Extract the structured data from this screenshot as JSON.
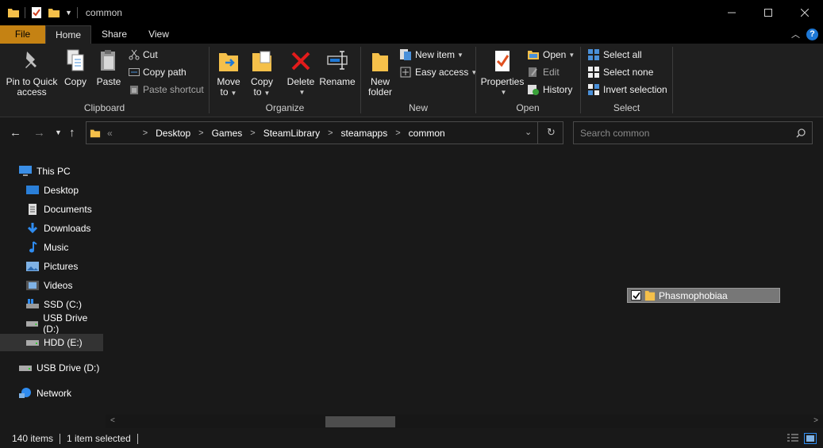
{
  "window": {
    "title": "common",
    "controls": [
      "minimize",
      "maximize",
      "close"
    ]
  },
  "tabs": [
    {
      "label": "File"
    },
    {
      "label": "Home"
    },
    {
      "label": "Share"
    },
    {
      "label": "View"
    }
  ],
  "ribbon": {
    "clipboard": {
      "label": "Clipboard",
      "pin": "Pin to Quick",
      "pin2": "access",
      "copy": "Copy",
      "paste": "Paste",
      "cut": "Cut",
      "copy_path": "Copy path",
      "paste_shortcut": "Paste shortcut"
    },
    "organize": {
      "label": "Organize",
      "move": "Move",
      "move2": "to",
      "copy": "Copy",
      "copy2": "to",
      "delete": "Delete",
      "rename": "Rename"
    },
    "new": {
      "label": "New",
      "new_folder": "New",
      "new_folder2": "folder",
      "new_item": "New item",
      "easy_access": "Easy access"
    },
    "open": {
      "label": "Open",
      "properties": "Properties",
      "open": "Open",
      "edit": "Edit",
      "history": "History"
    },
    "select": {
      "label": "Select",
      "select_all": "Select all",
      "select_none": "Select none",
      "invert": "Invert selection"
    }
  },
  "address": {
    "overflow": "«",
    "crumbs": [
      "Desktop",
      "Games",
      "SteamLibrary",
      "steamapps",
      "common"
    ]
  },
  "search": {
    "placeholder": "Search common"
  },
  "sidebar": {
    "items": [
      {
        "label": "This PC",
        "icon": "monitor-icon"
      },
      {
        "label": "Desktop",
        "icon": "desktop-icon"
      },
      {
        "label": "Documents",
        "icon": "documents-icon"
      },
      {
        "label": "Downloads",
        "icon": "download-icon"
      },
      {
        "label": "Music",
        "icon": "music-icon"
      },
      {
        "label": "Pictures",
        "icon": "pictures-icon"
      },
      {
        "label": "Videos",
        "icon": "videos-icon"
      },
      {
        "label": "SSD (C:)",
        "icon": "drive-icon"
      },
      {
        "label": "USB Drive (D:)",
        "icon": "drive-icon"
      },
      {
        "label": "HDD (E:)",
        "icon": "drive-icon",
        "selected": true
      },
      {
        "label": "USB Drive (D:)",
        "icon": "drive-icon"
      },
      {
        "label": "Network",
        "icon": "network-icon"
      }
    ]
  },
  "content": {
    "selected_folder": "Phasmophobiaa",
    "checked": true
  },
  "status": {
    "count": "140 items",
    "selected": "1 item selected"
  },
  "colors": {
    "file_tab": "#c58213",
    "folder": "#f5c04a",
    "accent_blue": "#1e78d6",
    "selection": "#777777"
  }
}
